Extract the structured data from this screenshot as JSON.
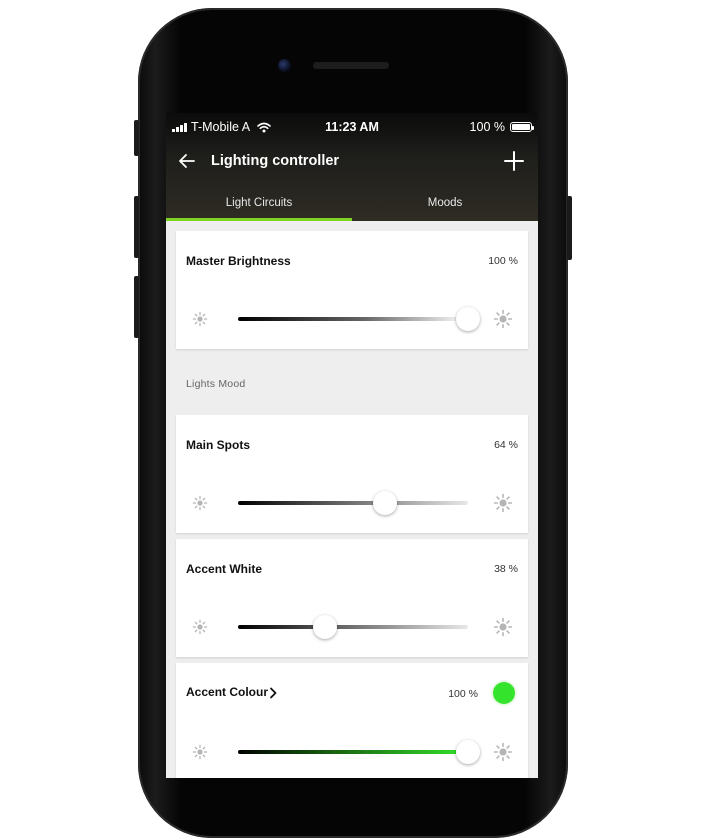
{
  "status_bar": {
    "carrier": "T-Mobile A",
    "time": "11:23 AM",
    "battery": "100 %"
  },
  "app_bar": {
    "title": "Lighting controller",
    "back_icon": "arrow-left-icon",
    "add_icon": "plus-icon"
  },
  "tabs": [
    {
      "label": "Light Circuits",
      "active": true
    },
    {
      "label": "Moods",
      "active": false
    }
  ],
  "master": {
    "label": "Master Brightness",
    "value_text": "100 %",
    "level": 1.0
  },
  "section": {
    "label": "Lights Mood"
  },
  "circuits": [
    {
      "label": "Main Spots",
      "value_text": "64 %",
      "level": 0.64
    },
    {
      "label": "Accent White",
      "value_text": "38 %",
      "level": 0.38
    }
  ],
  "accent_colour": {
    "label": "Accent Colour",
    "value_text": "100 %",
    "level": 1.0,
    "colour": "#34e32b"
  },
  "colors": {
    "accent_tab_indicator": "#7ed321",
    "accent_green": "#34e32b"
  }
}
